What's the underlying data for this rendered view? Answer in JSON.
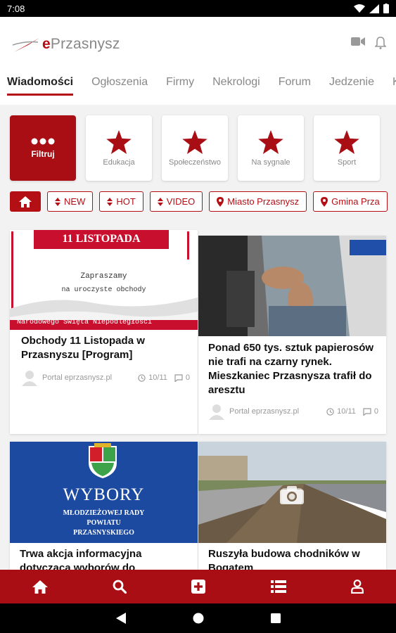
{
  "status_bar": {
    "time": "7:08"
  },
  "app": {
    "logo_prefix": "e",
    "logo_name": "Przasnysz",
    "tabs": [
      "Wiadomości",
      "Ogłoszenia",
      "Firmy",
      "Nekrologi",
      "Forum",
      "Jedzenie",
      "Ka"
    ]
  },
  "categories": [
    {
      "label": "Filtruj",
      "icon": "dots-icon",
      "active": true
    },
    {
      "label": "Edukacja",
      "icon": "star-icon"
    },
    {
      "label": "Społeczeństwo",
      "icon": "star-icon"
    },
    {
      "label": "Na sygnale",
      "icon": "star-icon"
    },
    {
      "label": "Sport",
      "icon": "star-icon"
    }
  ],
  "filters": {
    "new": "NEW",
    "hot": "HOT",
    "video": "VIDEO",
    "city": "Miasto Przasnysz",
    "gmina": "Gmina Prza"
  },
  "articles": [
    {
      "title": "Obchody 11 Listopada w Przasnyszu [Program]",
      "author": "Portal eprzasnysz.pl",
      "date": "10/11",
      "comments": "0",
      "image": {
        "banner": "11 LISTOPADA",
        "line1": "Zapraszamy",
        "line2": "na uroczyste obchody",
        "line3": "Narodowego Święta Niepodległości"
      }
    },
    {
      "title": "Ponad 650 tys. sztuk papierosów nie trafi na czarny rynek. Mieszkaniec Przasnysza trafił do aresztu",
      "author": "Portal eprzasnysz.pl",
      "date": "10/11",
      "comments": "0"
    },
    {
      "title": "Trwa akcja informacyjna dotycząca wyborów do Młodzieżowej Rady",
      "image": {
        "heading": "WYBORY",
        "sub1": "MŁODZIEŻOWEJ RADY",
        "sub2": "POWIATU",
        "sub3": "PRZASNYSKIEGO"
      }
    },
    {
      "title": "Ruszyła budowa chodników w Bogatem"
    }
  ],
  "colors": {
    "brand": "#b40f14",
    "nav": "#a80e13"
  }
}
